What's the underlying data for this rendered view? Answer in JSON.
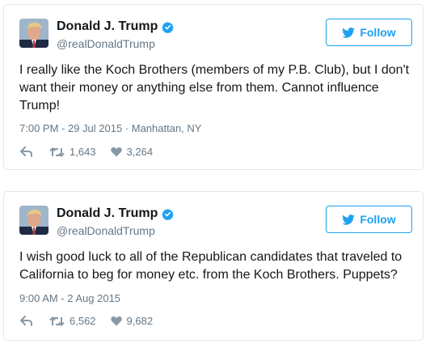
{
  "tweets": [
    {
      "display_name": "Donald J. Trump",
      "handle": "@realDonaldTrump",
      "follow_label": "Follow",
      "text": "I really like the Koch Brothers (members of my P.B. Club), but I don't want their money or anything else from them. Cannot influence Trump!",
      "timestamp": "7:00 PM - 29 Jul 2015 · Manhattan, NY",
      "retweets": "1,643",
      "likes": "3,264"
    },
    {
      "display_name": "Donald J. Trump",
      "handle": "@realDonaldTrump",
      "follow_label": "Follow",
      "text": "I wish good luck to all of the Republican candidates that traveled to California to beg for money etc. from the Koch Brothers. Puppets?",
      "timestamp": "9:00 AM - 2 Aug 2015",
      "retweets": "6,562",
      "likes": "9,682"
    }
  ],
  "colors": {
    "accent": "#1da1f2",
    "text": "#14171a",
    "muted": "#657786",
    "border": "#e1e8ed"
  },
  "icons": {
    "verified": "verified-badge-icon",
    "bird": "twitter-bird-icon",
    "reply": "reply-icon",
    "retweet": "retweet-icon",
    "like": "heart-icon"
  }
}
